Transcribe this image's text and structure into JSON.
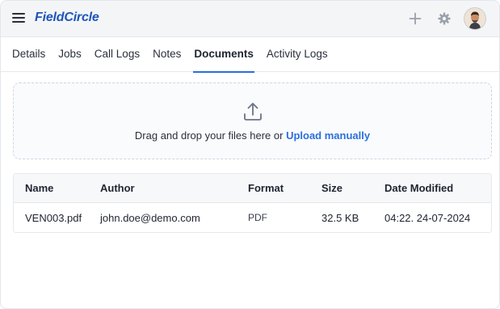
{
  "app": {
    "logo_text": "FieldCircle",
    "brand_color": "#1e56b8",
    "accent_color": "#2a6fdb",
    "top_icons": [
      "menu-icon",
      "plus-icon",
      "gear-icon",
      "user-avatar"
    ]
  },
  "tabs": [
    {
      "label": "Details",
      "active": false
    },
    {
      "label": "Jobs",
      "active": false
    },
    {
      "label": "Call Logs",
      "active": false
    },
    {
      "label": "Notes",
      "active": false
    },
    {
      "label": "Documents",
      "active": true
    },
    {
      "label": "Activity Logs",
      "active": false
    }
  ],
  "dropzone": {
    "icon": "upload-icon",
    "text": "Drag and drop your files here or ",
    "link_label": "Upload manually"
  },
  "table": {
    "columns": [
      "Name",
      "Author",
      "Format",
      "Size",
      "Date Modified"
    ],
    "rows": [
      [
        "VEN003.pdf",
        "john.doe@demo.com",
        "PDF",
        "32.5 KB",
        "04:22. 24-07-2024"
      ]
    ]
  }
}
